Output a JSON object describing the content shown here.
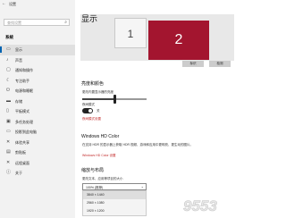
{
  "window": {
    "title": "设置",
    "back_icon": "back-arrow-icon"
  },
  "sidebar": {
    "search_placeholder": "查找设置",
    "section_label": "系统",
    "items": [
      {
        "label": "显示",
        "icon": "display-icon",
        "active": true
      },
      {
        "label": "声音",
        "icon": "sound-icon",
        "active": false
      },
      {
        "label": "通知和操作",
        "icon": "notifications-icon",
        "active": false
      },
      {
        "label": "专注助手",
        "icon": "focus-assist-icon",
        "active": false
      },
      {
        "label": "电源和睡眠",
        "icon": "power-icon",
        "active": false
      },
      {
        "label": "存储",
        "icon": "storage-icon",
        "active": false
      },
      {
        "label": "平板模式",
        "icon": "tablet-mode-icon",
        "active": false
      },
      {
        "label": "多任务处理",
        "icon": "multitasking-icon",
        "active": false
      },
      {
        "label": "投影到此电脑",
        "icon": "projecting-icon",
        "active": false
      },
      {
        "label": "体验共享",
        "icon": "shared-experiences-icon",
        "active": false
      },
      {
        "label": "剪贴板",
        "icon": "clipboard-icon",
        "active": false
      },
      {
        "label": "远程桌面",
        "icon": "remote-desktop-icon",
        "active": false
      },
      {
        "label": "关于",
        "icon": "about-icon",
        "active": false
      }
    ]
  },
  "main": {
    "title": "显示",
    "monitors": [
      "1",
      "2"
    ],
    "identify_label": "标识",
    "detect_label": "检测",
    "brightness": {
      "title": "亮度和颜色",
      "slider_label": "更改内置显示器的亮度",
      "brightness_level": 0.5,
      "night_light_label": "夜间模式",
      "night_light_state": "关",
      "night_light_link": "夜间模式设置"
    },
    "hdr": {
      "title": "Windows HD Color",
      "description": "在支持 HDR 的显示器上获取 HDR 视频、游戏和应用中更明亮、更生动的图片。",
      "link": "Windows HD Color 设置"
    },
    "scale": {
      "title": "缩放与布局",
      "label": "更改文本、应用等项目的大小",
      "selected": "100% (推荐)",
      "options": [
        "3840 × 1440",
        "2560 × 1080",
        "1920 × 1200"
      ]
    }
  },
  "watermark": "9553"
}
